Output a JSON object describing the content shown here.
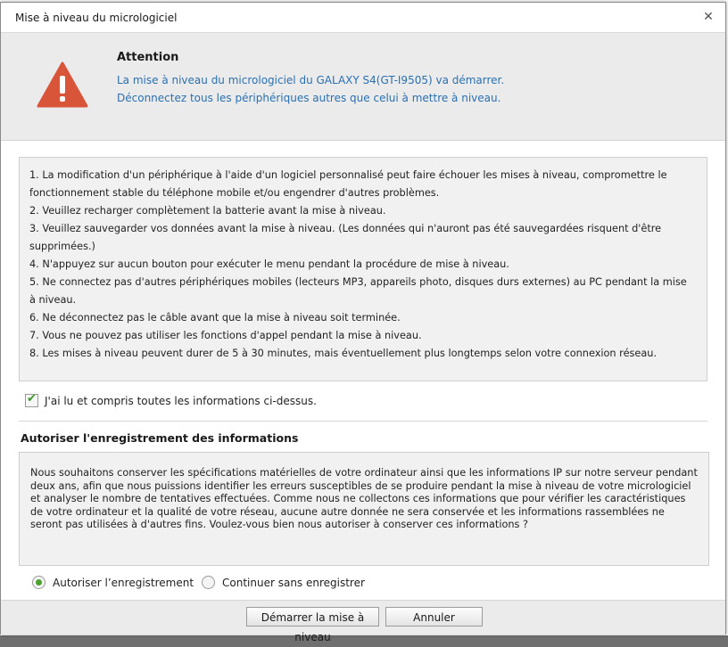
{
  "dialog": {
    "title": "Mise à niveau du micrologiciel",
    "close_icon": "close-icon"
  },
  "header": {
    "icon": "warning-icon",
    "icon_color": "#d9553a",
    "attention": "Attention",
    "line1": "La mise à niveau du micrologiciel du GALAXY S4(GT-I9505) va démarrer.",
    "line2": "Déconnectez tous les périphériques autres que celui à mettre à niveau."
  },
  "instructions": [
    "1. La modification d'un périphérique à l'aide d'un logiciel personnalisé peut faire échouer les mises à niveau, compromettre le",
    "fonctionnement stable du téléphone mobile et/ou engendrer d'autres problèmes.",
    "2. Veuillez recharger complètement la batterie avant la mise à niveau.",
    "3. Veuillez sauvegarder vos données avant la mise à niveau. (Les données qui n'auront pas été sauvegardées risquent d'être supprimées.)",
    "4. N'appuyez sur aucun bouton pour exécuter le menu pendant la procédure de mise à niveau.",
    "5. Ne connectez pas d'autres périphériques mobiles (lecteurs MP3, appareils photo, disques durs externes) au PC pendant la mise à niveau.",
    "6. Ne déconnectez pas le câble avant que la mise à niveau soit terminée.",
    "7. Vous ne pouvez pas utiliser les fonctions d'appel pendant la mise à niveau.",
    "8. Les mises à niveau peuvent durer de 5 à 30 minutes, mais éventuellement plus longtemps selon votre connexion réseau."
  ],
  "acknowledge": {
    "label": "J'ai lu et compris toutes les informations ci-dessus.",
    "checked": true
  },
  "consent": {
    "title": "Autoriser l'enregistrement des informations",
    "text": "Nous souhaitons conserver les spécifications matérielles de votre ordinateur ainsi que les informations IP sur notre serveur pendant deux ans, afin que nous puissions identifier les erreurs susceptibles de se produire pendant la mise à niveau de votre micrologiciel et analyser le nombre de tentatives effectuées. Comme nous ne collectons ces informations que pour vérifier les caractéristiques de votre ordinateur et la qualité de votre réseau, aucune autre donnée ne sera conservée et les informations rassemblées ne seront pas utilisées à d'autres fins. Voulez-vous bien nous autoriser à conserver ces informations ?",
    "options": [
      {
        "label": "Autoriser l’enregistrement",
        "selected": true
      },
      {
        "label": "Continuer sans enregistrer",
        "selected": false
      }
    ]
  },
  "buttons": {
    "start": "Démarrer la mise à niveau",
    "cancel": "Annuler"
  }
}
